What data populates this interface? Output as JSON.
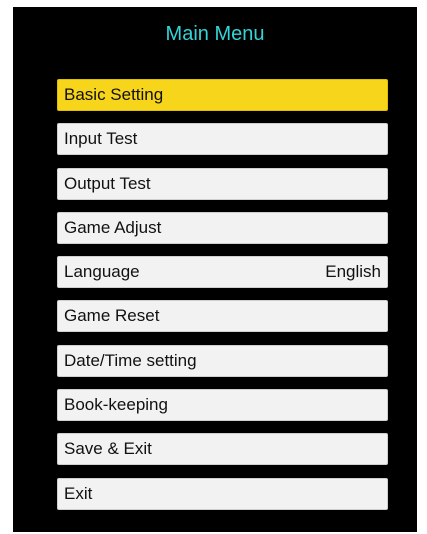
{
  "title": "Main Menu",
  "colors": {
    "title": "#33d4d8",
    "selected": "#f7d51a",
    "item_bg": "#f2f2f2",
    "screen_bg": "#000000"
  },
  "menu": {
    "selected_index": 0,
    "items": [
      {
        "label": "Basic Setting"
      },
      {
        "label": "Input Test"
      },
      {
        "label": "Output Test"
      },
      {
        "label": "Game Adjust"
      },
      {
        "label": "Language",
        "value": "English"
      },
      {
        "label": "Game Reset"
      },
      {
        "label": "Date/Time setting"
      },
      {
        "label": "Book-keeping"
      },
      {
        "label": "Save & Exit"
      },
      {
        "label": "Exit"
      }
    ]
  }
}
